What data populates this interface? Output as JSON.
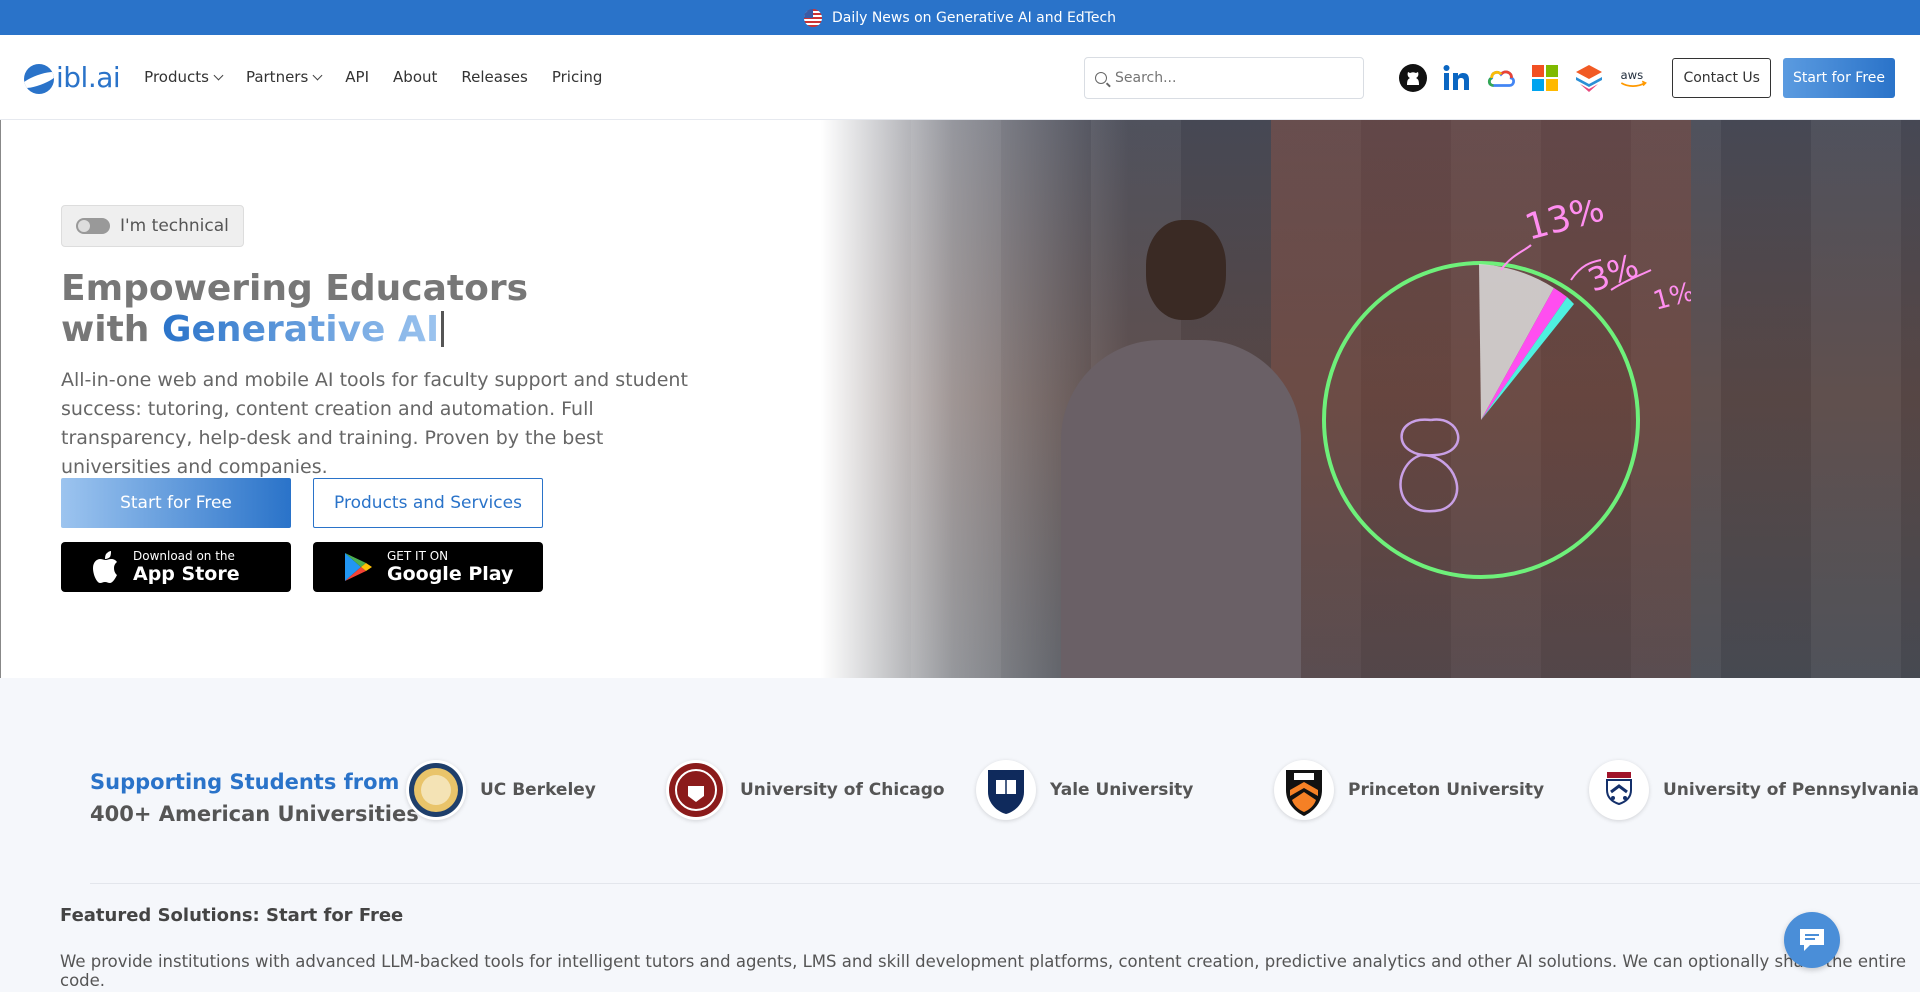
{
  "banner": {
    "text": "Daily News on Generative AI and EdTech"
  },
  "logo": {
    "text": "ibl.ai"
  },
  "nav": {
    "items": [
      {
        "label": "Products",
        "dropdown": true
      },
      {
        "label": "Partners",
        "dropdown": true
      },
      {
        "label": "API",
        "dropdown": false
      },
      {
        "label": "About",
        "dropdown": false
      },
      {
        "label": "Releases",
        "dropdown": false
      },
      {
        "label": "Pricing",
        "dropdown": false
      }
    ],
    "search_placeholder": "Search...",
    "partner_icons": [
      "github-icon",
      "linkedin-icon",
      "google-cloud-icon",
      "microsoft-icon",
      "layers-icon",
      "aws-icon"
    ],
    "contact_label": "Contact Us",
    "start_label": "Start for Free"
  },
  "hero": {
    "toggle_label": "I'm technical",
    "title_line1": "Empowering Educators",
    "title_line2_prefix": "with ",
    "title_line2_accent": "Generative AI",
    "subtitle": "All-in-one web and mobile AI tools for faculty support and student success: tutoring, content creation and automation. Full transparency, help-desk and training. Proven by the best universities and companies.",
    "start_button": "Start for Free",
    "products_button": "Products and Services",
    "app_store_small": "Download on the",
    "app_store_big": "App Store",
    "google_play_small": "GET IT ON",
    "google_play_big": "Google Play",
    "board_text": [
      "13%",
      "3%",
      "1%",
      "8"
    ]
  },
  "universities": {
    "heading_line1": "Supporting Students from",
    "heading_line2": "400+ American Universities",
    "list": [
      {
        "name": "UC Berkeley"
      },
      {
        "name": "University of Chicago"
      },
      {
        "name": "Yale University"
      },
      {
        "name": "Princeton University"
      },
      {
        "name": "University of Pennsylvania"
      }
    ]
  },
  "featured": {
    "title": "Featured Solutions: Start for Free",
    "description": "We provide institutions with advanced LLM-backed tools for intelligent tutors and agents, LMS and skill development platforms, content creation, predictive analytics and other AI solutions. We can optionally share the entire code."
  },
  "colors": {
    "brand": "#2a73c9",
    "banner": "#2a73c9"
  }
}
